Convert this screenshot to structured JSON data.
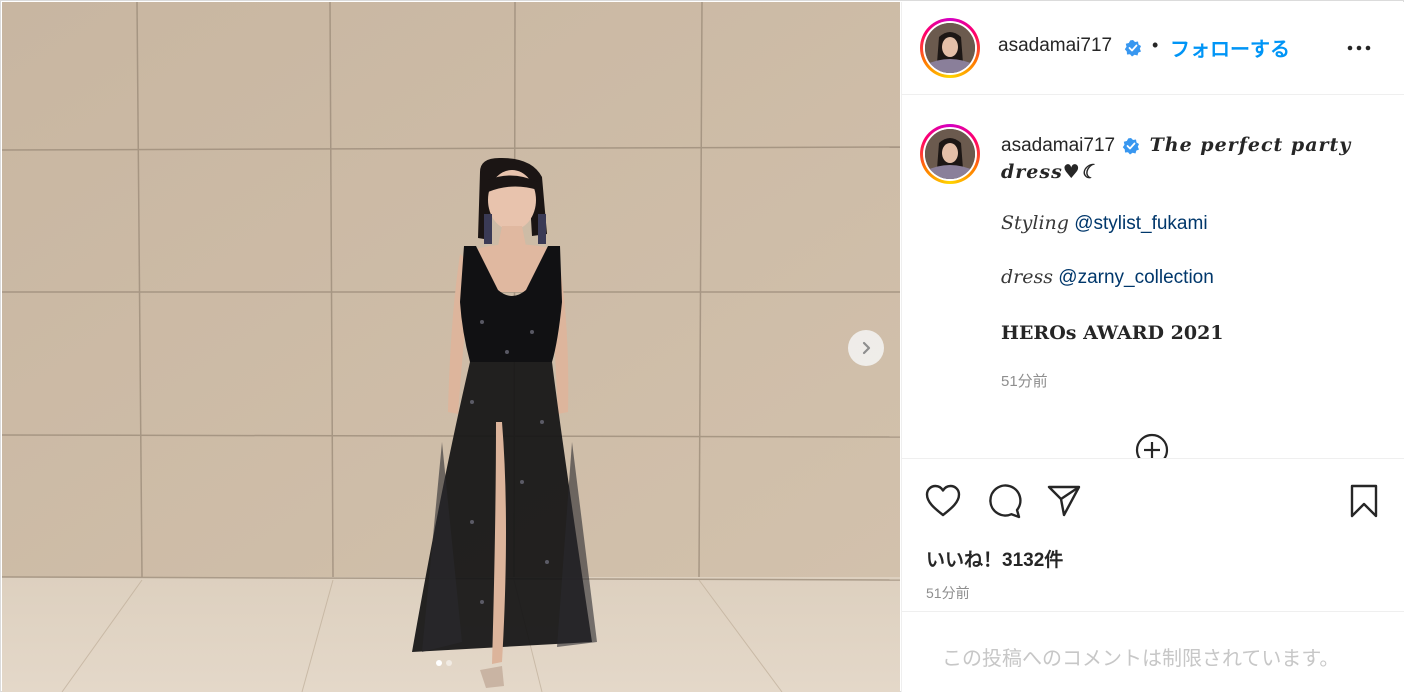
{
  "header": {
    "username": "asadamai717",
    "separator": "•",
    "follow_label": "フォローする"
  },
  "caption": {
    "username": "asadamai717",
    "title": "The perfect party dress♥☾",
    "styling_label": "Styling",
    "styling_mention": "@stylist_fukami",
    "dress_label": "dress",
    "dress_mention": "@zarny_collection",
    "event": "HEROs AWARD 2021",
    "time": "51分前"
  },
  "actions": {
    "likes": "いいね！3132件",
    "time": "51分前",
    "comment_notice": "この投稿へのコメントは制限されています。"
  },
  "carousel": {
    "total": 2,
    "current": 1
  },
  "icons": [
    "chevron-right-icon",
    "verified-badge-icon",
    "more-options-icon",
    "add-circle-icon",
    "heart-icon",
    "comment-icon",
    "share-icon",
    "bookmark-icon"
  ],
  "colors": {
    "accent": "#0095f6",
    "mention": "#00376b",
    "muted": "#8e8e8e"
  }
}
